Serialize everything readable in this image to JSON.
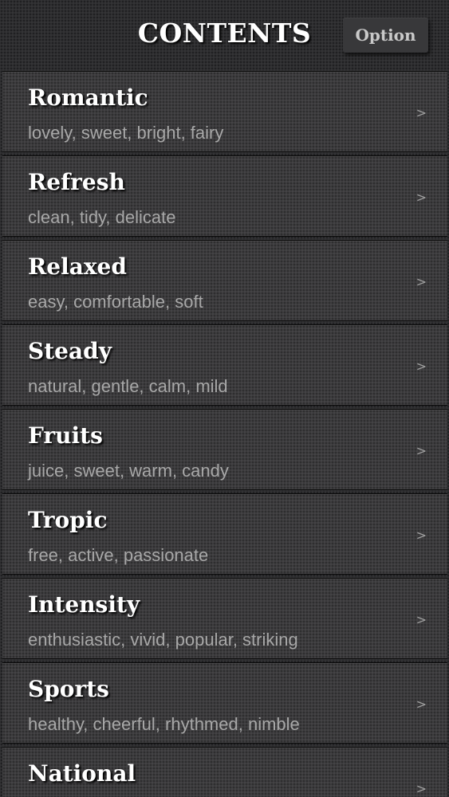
{
  "header": {
    "title": "CONTENTS",
    "option_label": "Option"
  },
  "items": [
    {
      "title": "Romantic",
      "desc": "lovely, sweet, bright, fairy",
      "chevron": ">"
    },
    {
      "title": "Refresh",
      "desc": "clean, tidy, delicate",
      "chevron": ">"
    },
    {
      "title": "Relaxed",
      "desc": "easy, comfortable, soft",
      "chevron": ">"
    },
    {
      "title": "Steady",
      "desc": "natural, gentle, calm, mild",
      "chevron": ">"
    },
    {
      "title": "Fruits",
      "desc": "juice, sweet, warm, candy",
      "chevron": ">"
    },
    {
      "title": "Tropic",
      "desc": "free, active, passionate",
      "chevron": ">"
    },
    {
      "title": "Intensity",
      "desc": "enthusiastic, vivid, popular, striking",
      "chevron": ">"
    },
    {
      "title": "Sports",
      "desc": "healthy, cheerful, rhythmed, nimble",
      "chevron": ">"
    },
    {
      "title": "National",
      "desc": "",
      "chevron": ">"
    }
  ],
  "colors": {
    "background": "#2e2e30",
    "row": "#3c3b3d",
    "title_text": "#ffffff",
    "desc_text": "#a8a8a8"
  }
}
